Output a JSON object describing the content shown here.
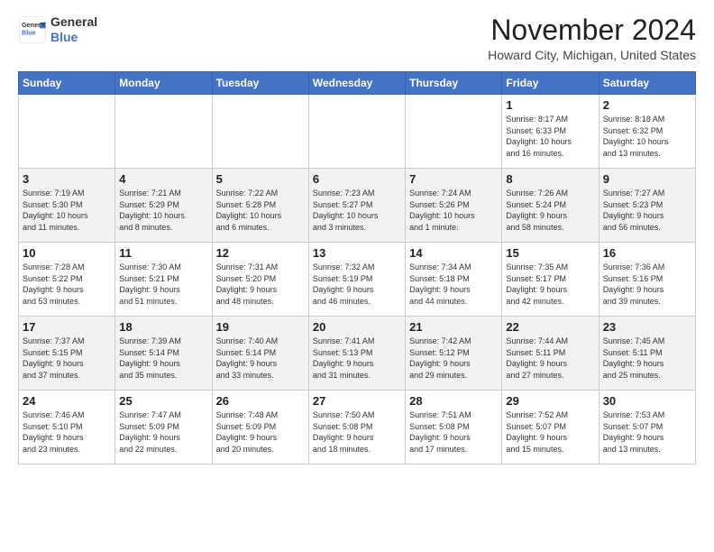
{
  "header": {
    "logo_line1": "General",
    "logo_line2": "Blue",
    "month": "November 2024",
    "location": "Howard City, Michigan, United States"
  },
  "days_of_week": [
    "Sunday",
    "Monday",
    "Tuesday",
    "Wednesday",
    "Thursday",
    "Friday",
    "Saturday"
  ],
  "weeks": [
    [
      {
        "day": "",
        "info": ""
      },
      {
        "day": "",
        "info": ""
      },
      {
        "day": "",
        "info": ""
      },
      {
        "day": "",
        "info": ""
      },
      {
        "day": "",
        "info": ""
      },
      {
        "day": "1",
        "info": "Sunrise: 8:17 AM\nSunset: 6:33 PM\nDaylight: 10 hours\nand 16 minutes."
      },
      {
        "day": "2",
        "info": "Sunrise: 8:18 AM\nSunset: 6:32 PM\nDaylight: 10 hours\nand 13 minutes."
      }
    ],
    [
      {
        "day": "3",
        "info": "Sunrise: 7:19 AM\nSunset: 5:30 PM\nDaylight: 10 hours\nand 11 minutes."
      },
      {
        "day": "4",
        "info": "Sunrise: 7:21 AM\nSunset: 5:29 PM\nDaylight: 10 hours\nand 8 minutes."
      },
      {
        "day": "5",
        "info": "Sunrise: 7:22 AM\nSunset: 5:28 PM\nDaylight: 10 hours\nand 6 minutes."
      },
      {
        "day": "6",
        "info": "Sunrise: 7:23 AM\nSunset: 5:27 PM\nDaylight: 10 hours\nand 3 minutes."
      },
      {
        "day": "7",
        "info": "Sunrise: 7:24 AM\nSunset: 5:26 PM\nDaylight: 10 hours\nand 1 minute."
      },
      {
        "day": "8",
        "info": "Sunrise: 7:26 AM\nSunset: 5:24 PM\nDaylight: 9 hours\nand 58 minutes."
      },
      {
        "day": "9",
        "info": "Sunrise: 7:27 AM\nSunset: 5:23 PM\nDaylight: 9 hours\nand 56 minutes."
      }
    ],
    [
      {
        "day": "10",
        "info": "Sunrise: 7:28 AM\nSunset: 5:22 PM\nDaylight: 9 hours\nand 53 minutes."
      },
      {
        "day": "11",
        "info": "Sunrise: 7:30 AM\nSunset: 5:21 PM\nDaylight: 9 hours\nand 51 minutes."
      },
      {
        "day": "12",
        "info": "Sunrise: 7:31 AM\nSunset: 5:20 PM\nDaylight: 9 hours\nand 48 minutes."
      },
      {
        "day": "13",
        "info": "Sunrise: 7:32 AM\nSunset: 5:19 PM\nDaylight: 9 hours\nand 46 minutes."
      },
      {
        "day": "14",
        "info": "Sunrise: 7:34 AM\nSunset: 5:18 PM\nDaylight: 9 hours\nand 44 minutes."
      },
      {
        "day": "15",
        "info": "Sunrise: 7:35 AM\nSunset: 5:17 PM\nDaylight: 9 hours\nand 42 minutes."
      },
      {
        "day": "16",
        "info": "Sunrise: 7:36 AM\nSunset: 5:16 PM\nDaylight: 9 hours\nand 39 minutes."
      }
    ],
    [
      {
        "day": "17",
        "info": "Sunrise: 7:37 AM\nSunset: 5:15 PM\nDaylight: 9 hours\nand 37 minutes."
      },
      {
        "day": "18",
        "info": "Sunrise: 7:39 AM\nSunset: 5:14 PM\nDaylight: 9 hours\nand 35 minutes."
      },
      {
        "day": "19",
        "info": "Sunrise: 7:40 AM\nSunset: 5:14 PM\nDaylight: 9 hours\nand 33 minutes."
      },
      {
        "day": "20",
        "info": "Sunrise: 7:41 AM\nSunset: 5:13 PM\nDaylight: 9 hours\nand 31 minutes."
      },
      {
        "day": "21",
        "info": "Sunrise: 7:42 AM\nSunset: 5:12 PM\nDaylight: 9 hours\nand 29 minutes."
      },
      {
        "day": "22",
        "info": "Sunrise: 7:44 AM\nSunset: 5:11 PM\nDaylight: 9 hours\nand 27 minutes."
      },
      {
        "day": "23",
        "info": "Sunrise: 7:45 AM\nSunset: 5:11 PM\nDaylight: 9 hours\nand 25 minutes."
      }
    ],
    [
      {
        "day": "24",
        "info": "Sunrise: 7:46 AM\nSunset: 5:10 PM\nDaylight: 9 hours\nand 23 minutes."
      },
      {
        "day": "25",
        "info": "Sunrise: 7:47 AM\nSunset: 5:09 PM\nDaylight: 9 hours\nand 22 minutes."
      },
      {
        "day": "26",
        "info": "Sunrise: 7:48 AM\nSunset: 5:09 PM\nDaylight: 9 hours\nand 20 minutes."
      },
      {
        "day": "27",
        "info": "Sunrise: 7:50 AM\nSunset: 5:08 PM\nDaylight: 9 hours\nand 18 minutes."
      },
      {
        "day": "28",
        "info": "Sunrise: 7:51 AM\nSunset: 5:08 PM\nDaylight: 9 hours\nand 17 minutes."
      },
      {
        "day": "29",
        "info": "Sunrise: 7:52 AM\nSunset: 5:07 PM\nDaylight: 9 hours\nand 15 minutes."
      },
      {
        "day": "30",
        "info": "Sunrise: 7:53 AM\nSunset: 5:07 PM\nDaylight: 9 hours\nand 13 minutes."
      }
    ]
  ]
}
